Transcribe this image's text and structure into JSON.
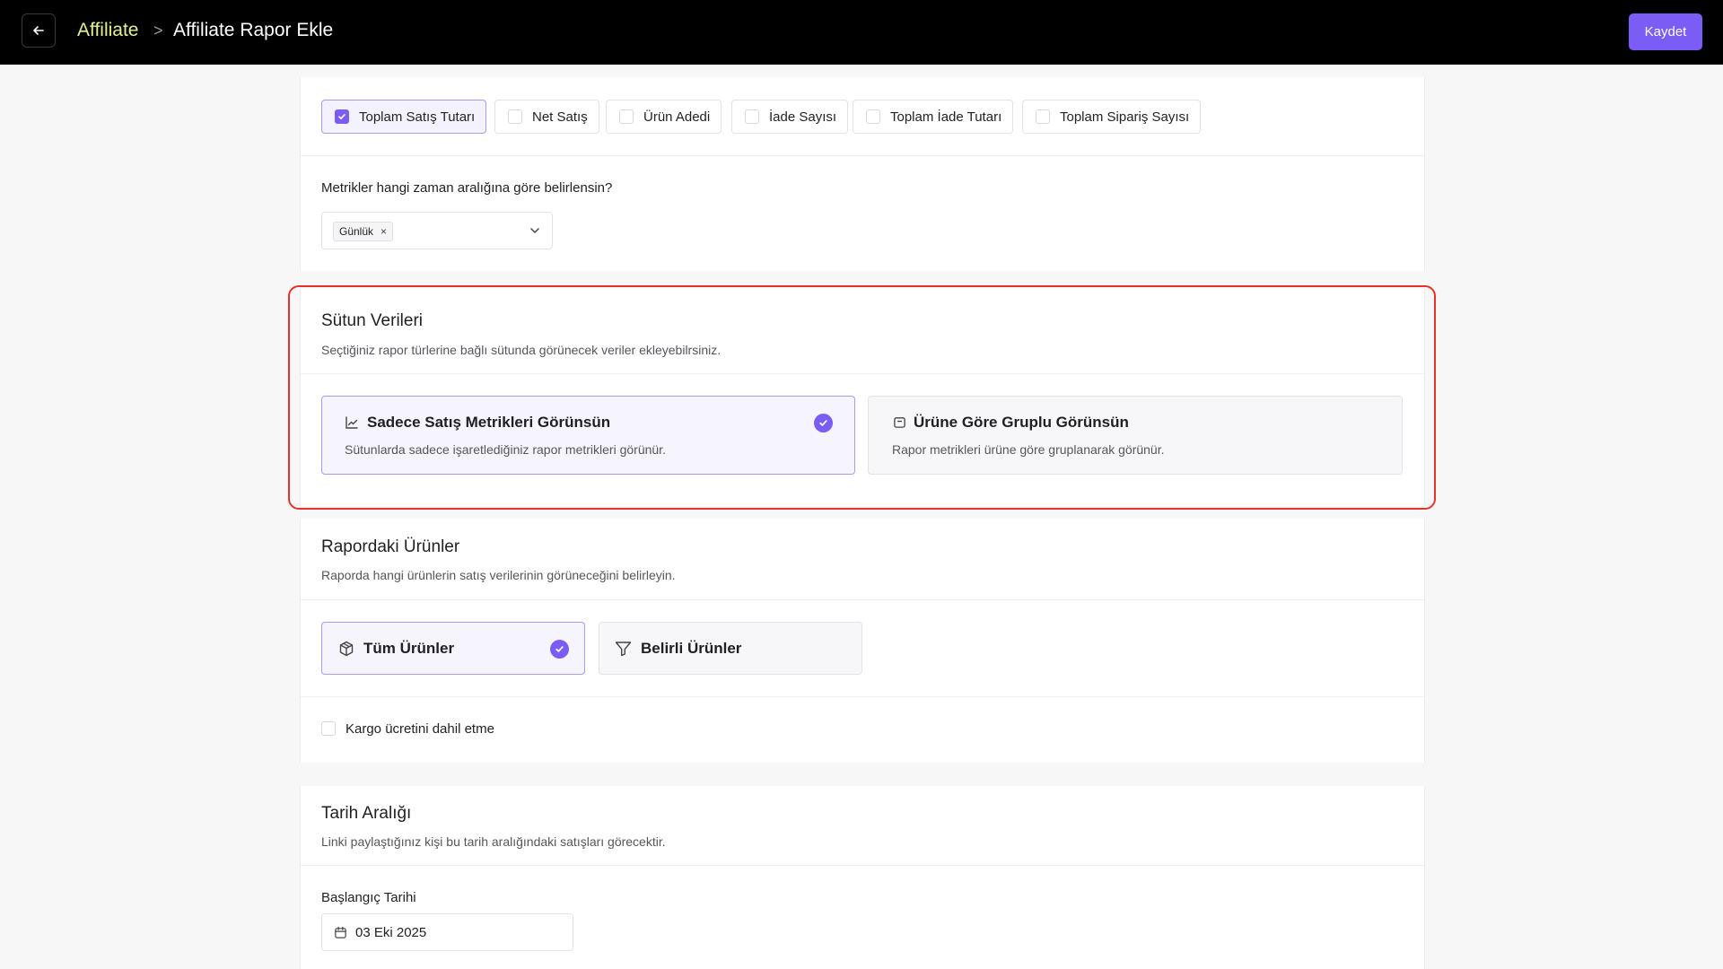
{
  "header": {
    "breadcrumb_root": "Affiliate",
    "breadcrumb_sep": ">",
    "title": "Affiliate Rapor Ekle",
    "save_label": "Kaydet"
  },
  "metrics": {
    "chips": [
      {
        "label": "Toplam Satış Tutarı",
        "checked": true
      },
      {
        "label": "Net Satış",
        "checked": false
      },
      {
        "label": "Ürün Adedi",
        "checked": false
      },
      {
        "label": "İade Sayısı",
        "checked": false
      },
      {
        "label": "Toplam İade Tutarı",
        "checked": false
      },
      {
        "label": "Toplam Sipariş Sayısı",
        "checked": false
      }
    ],
    "interval_question": "Metrikler hangi zaman aralığına göre belirlensin?",
    "interval_selected": "Günlük",
    "remove_glyph": "×"
  },
  "columns": {
    "title": "Sütun Verileri",
    "subtitle": "Seçtiğiniz rapor türlerine bağlı sütunda görünecek veriler ekleyebilrsiniz.",
    "options": [
      {
        "title": "Sadece Satış Metrikleri Görünsün",
        "desc": "Sütunlarda sadece işaretlediğiniz rapor metrikleri görünür.",
        "icon": "chart-line-icon",
        "selected": true
      },
      {
        "title": "Ürüne Göre Gruplu Görünsün",
        "desc": "Rapor metrikleri ürüne göre gruplanarak görünür.",
        "icon": "box-icon",
        "selected": false
      }
    ]
  },
  "products": {
    "title": "Rapordaki Ürünler",
    "subtitle": "Raporda hangi ürünlerin satış verilerinin görüneceğini belirleyin.",
    "options": [
      {
        "title": "Tüm Ürünler",
        "icon": "package-icon",
        "selected": true
      },
      {
        "title": "Belirli Ürünler",
        "icon": "filter-icon",
        "selected": false
      }
    ],
    "shipping_label": "Kargo ücretini dahil etme",
    "shipping_checked": false
  },
  "dates": {
    "title": "Tarih Aralığı",
    "subtitle": "Linki paylaştığınız kişi bu tarih aralığındaki satışları görecektir.",
    "start_label": "Başlangıç Tarihi",
    "start_value": "03 Eki 2025"
  },
  "colors": {
    "accent": "#7b5cf5",
    "highlight": "#e5322b",
    "breadcrumb_root": "#e6f08a"
  }
}
